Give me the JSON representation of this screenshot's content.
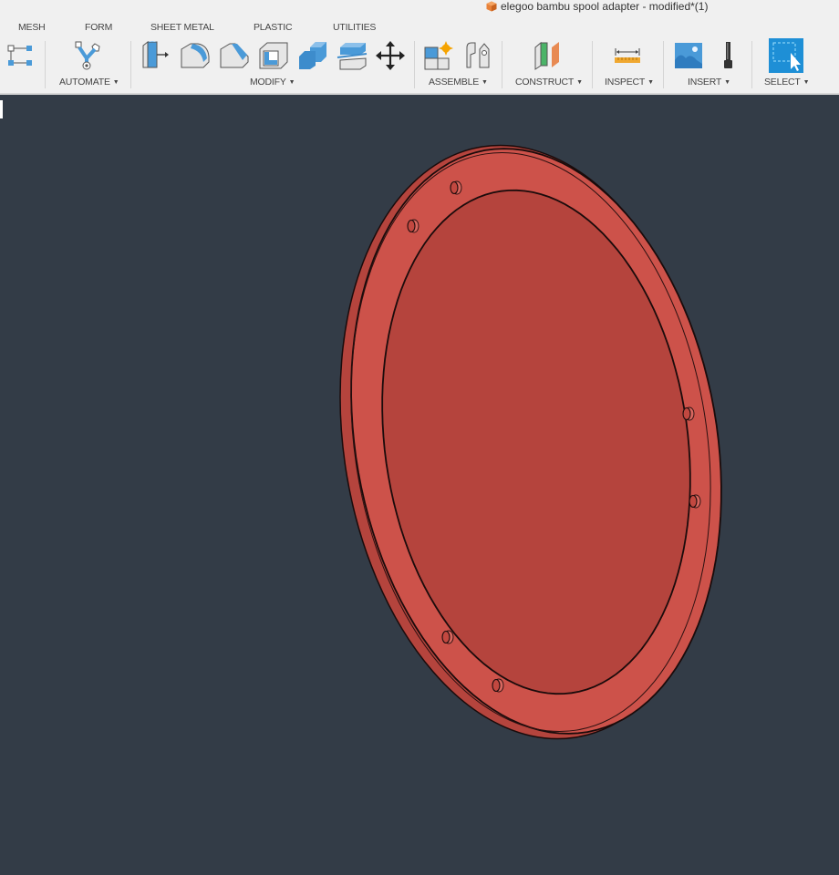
{
  "document": {
    "title": "elegoo bambu spool adapter - modified*(1)",
    "icon": "cube-icon",
    "icon_color": "#e8823a"
  },
  "tabs": [
    {
      "label": "MESH"
    },
    {
      "label": "FORM"
    },
    {
      "label": "SHEET METAL"
    },
    {
      "label": "PLASTIC"
    },
    {
      "label": "UTILITIES"
    }
  ],
  "groups": {
    "automate": {
      "label": "AUTOMATE"
    },
    "modify": {
      "label": "MODIFY"
    },
    "assemble": {
      "label": "ASSEMBLE"
    },
    "construct": {
      "label": "CONSTRUCT"
    },
    "inspect": {
      "label": "INSPECT"
    },
    "insert": {
      "label": "INSERT"
    },
    "select": {
      "label": "SELECT"
    }
  },
  "tools": [
    {
      "name": "sketch-dimension-tool",
      "icon": "constraint-nodes-icon"
    },
    {
      "name": "automate-tool",
      "icon": "automate-icon"
    },
    {
      "name": "press-pull-tool",
      "icon": "press-pull-icon"
    },
    {
      "name": "fillet-tool",
      "icon": "fillet-icon"
    },
    {
      "name": "chamfer-tool",
      "icon": "chamfer-icon"
    },
    {
      "name": "shell-tool",
      "icon": "shell-icon"
    },
    {
      "name": "combine-tool",
      "icon": "combine-icon"
    },
    {
      "name": "split-body-tool",
      "icon": "split-body-icon"
    },
    {
      "name": "move-copy-tool",
      "icon": "move-icon"
    },
    {
      "name": "new-component-tool",
      "icon": "new-component-icon"
    },
    {
      "name": "joint-tool",
      "icon": "joint-icon"
    },
    {
      "name": "offset-plane-tool",
      "icon": "offset-plane-icon"
    },
    {
      "name": "measure-tool",
      "icon": "measure-icon"
    },
    {
      "name": "insert-canvas-tool",
      "icon": "image-icon"
    },
    {
      "name": "insert-mcmaster-tool",
      "icon": "bolt-icon"
    },
    {
      "name": "select-tool",
      "icon": "select-icon"
    }
  ],
  "colors": {
    "toolbar_bg": "#f0f0f0",
    "viewport_bg": "#333c47",
    "body_color": "#cd524a",
    "body_edge": "#1a0b0b",
    "accent_blue": "#1e8fd6"
  },
  "model": {
    "name": "spool adapter ring",
    "hole_count": 6
  }
}
